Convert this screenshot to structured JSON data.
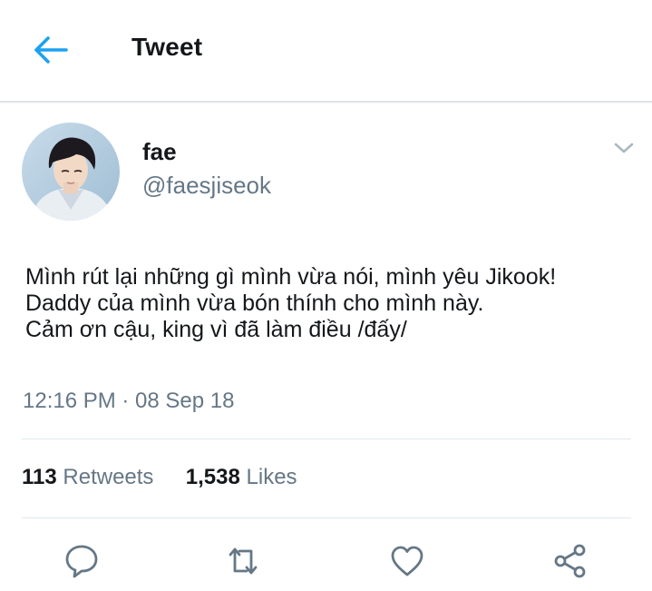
{
  "header": {
    "title": "Tweet",
    "back_icon": "arrow-left-icon",
    "accent_color": "#1da1f2"
  },
  "author": {
    "name": "fae",
    "handle": "@faesjiseok"
  },
  "tweet": {
    "lines": [
      "Mình rút lại những gì mình vừa nói, mình yêu Jikook!",
      "Daddy của mình vừa bón thính cho mình này.",
      "Cảm ơn cậu, king vì đã làm điều /đấy/"
    ],
    "timestamp": "12:16 PM · 08 Sep 18"
  },
  "stats": {
    "retweets_count": "113",
    "retweets_label": "Retweets",
    "likes_count": "1,538",
    "likes_label": "Likes"
  },
  "actions": {
    "icons": [
      "reply-icon",
      "retweet-icon",
      "like-icon",
      "share-icon"
    ],
    "icon_color": "#657786"
  }
}
